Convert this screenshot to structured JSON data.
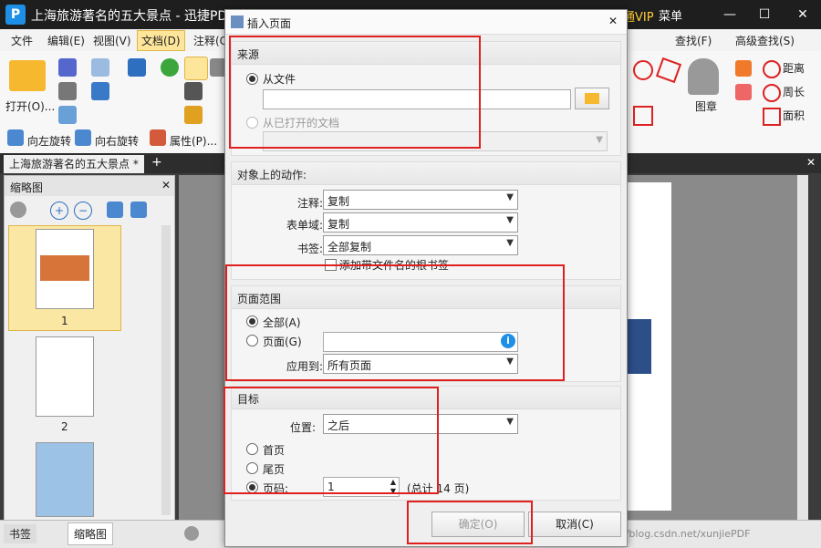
{
  "window": {
    "title": "上海旅游著名的五大景点 - 迅捷PDF编辑器",
    "vip": "开通VIP",
    "menu_label": "菜单",
    "min": "—",
    "max": "☐",
    "close": "✕"
  },
  "menubar": [
    "文件",
    "编辑(E)",
    "视图(V)",
    "文档(D)",
    "注释(C)"
  ],
  "ribbon": {
    "open_label": "打开(O)...",
    "rotate_left": "向左旋转",
    "rotate_right": "向右旋转",
    "properties": "属性(P)...",
    "find": "查找(F)",
    "advanced_find": "高级查找(S)",
    "stamp": "图章",
    "distance": "距离",
    "perimeter": "周长",
    "area": "面积"
  },
  "tab": {
    "doc": "上海旅游著名的五大景点 *",
    "add": "+",
    "close": "✕"
  },
  "leftpanel": {
    "title": "缩略图",
    "close": "✕",
    "pages": [
      "1",
      "2"
    ]
  },
  "bottom": {
    "bookmarks": "书签",
    "thumbnails": "缩略图",
    "watermark": "https://blog.csdn.net/xunjiePDF"
  },
  "dialog": {
    "title": "插入页面",
    "close": "✕",
    "source": {
      "header": "来源",
      "from_file": "从文件",
      "from_open": "从已打开的文档"
    },
    "actions": {
      "header": "对象上的动作:",
      "annotations_label": "注释:",
      "annotations_value": "复制",
      "formfields_label": "表单域:",
      "formfields_value": "复制",
      "bookmarks_label": "书签:",
      "bookmarks_value": "全部复制",
      "add_root_bookmark": "添加带文件名的根书签"
    },
    "range": {
      "header": "页面范围",
      "all": "全部(A)",
      "pages": "页面(G)",
      "apply_label": "应用到:",
      "apply_value": "所有页面"
    },
    "target": {
      "header": "目标",
      "position_label": "位置:",
      "position_value": "之后",
      "first": "首页",
      "last": "尾页",
      "page": "页码:",
      "page_value": "1",
      "total": "(总计 14 页)"
    },
    "ok": "确定(O)",
    "cancel": "取消(C)"
  },
  "colors": {
    "accent": "#1e8fe6",
    "highlight": "#e0201e",
    "titlebar": "#1e1e1e"
  }
}
